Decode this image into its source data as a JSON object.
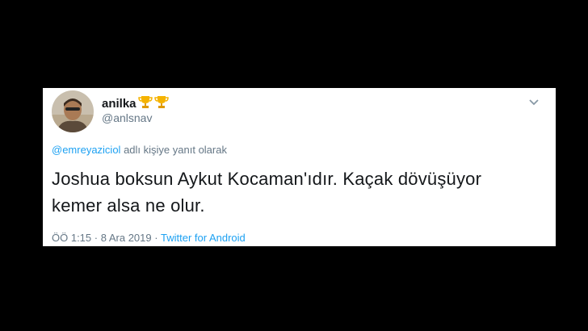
{
  "tweet": {
    "display_name": "anilka",
    "badge_icons": [
      "trophy-icon",
      "trophy-icon"
    ],
    "handle": "@anlsnav",
    "reply_to_handle": "@emreyaziciol",
    "reply_to_suffix": "adlı kişiye yanıt olarak",
    "text_line1": "Joshua boksun Aykut Kocaman'ıdır. Kaçak dövüşüyor",
    "text_line2": "kemer alsa ne olur.",
    "time": "ÖÖ 1:15",
    "date": "8 Ara 2019",
    "separator": "·",
    "source": "Twitter for Android"
  },
  "colors": {
    "background": "#000000",
    "card": "#ffffff",
    "text": "#14171a",
    "muted": "#657786",
    "link": "#1da1f2",
    "trophy": "#f5b301"
  }
}
